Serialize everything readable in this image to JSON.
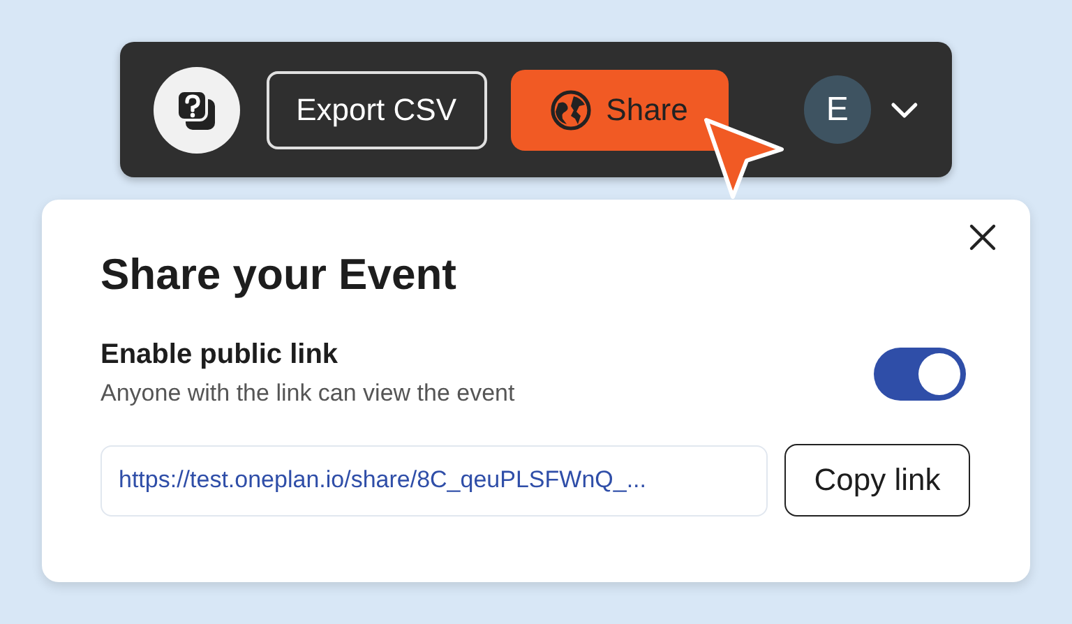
{
  "toolbar": {
    "export_button": "Export CSV",
    "share_button": "Share",
    "avatar": "E"
  },
  "share_dialog": {
    "title": "Share your Event",
    "public_link": {
      "label": "Enable public link",
      "description": "Anyone with the link can view the event",
      "on": true
    },
    "link": {
      "value": "https://test.oneplan.io/share/8C_qeuPLSFWnQ_..."
    },
    "copy_button": "Copy link"
  }
}
